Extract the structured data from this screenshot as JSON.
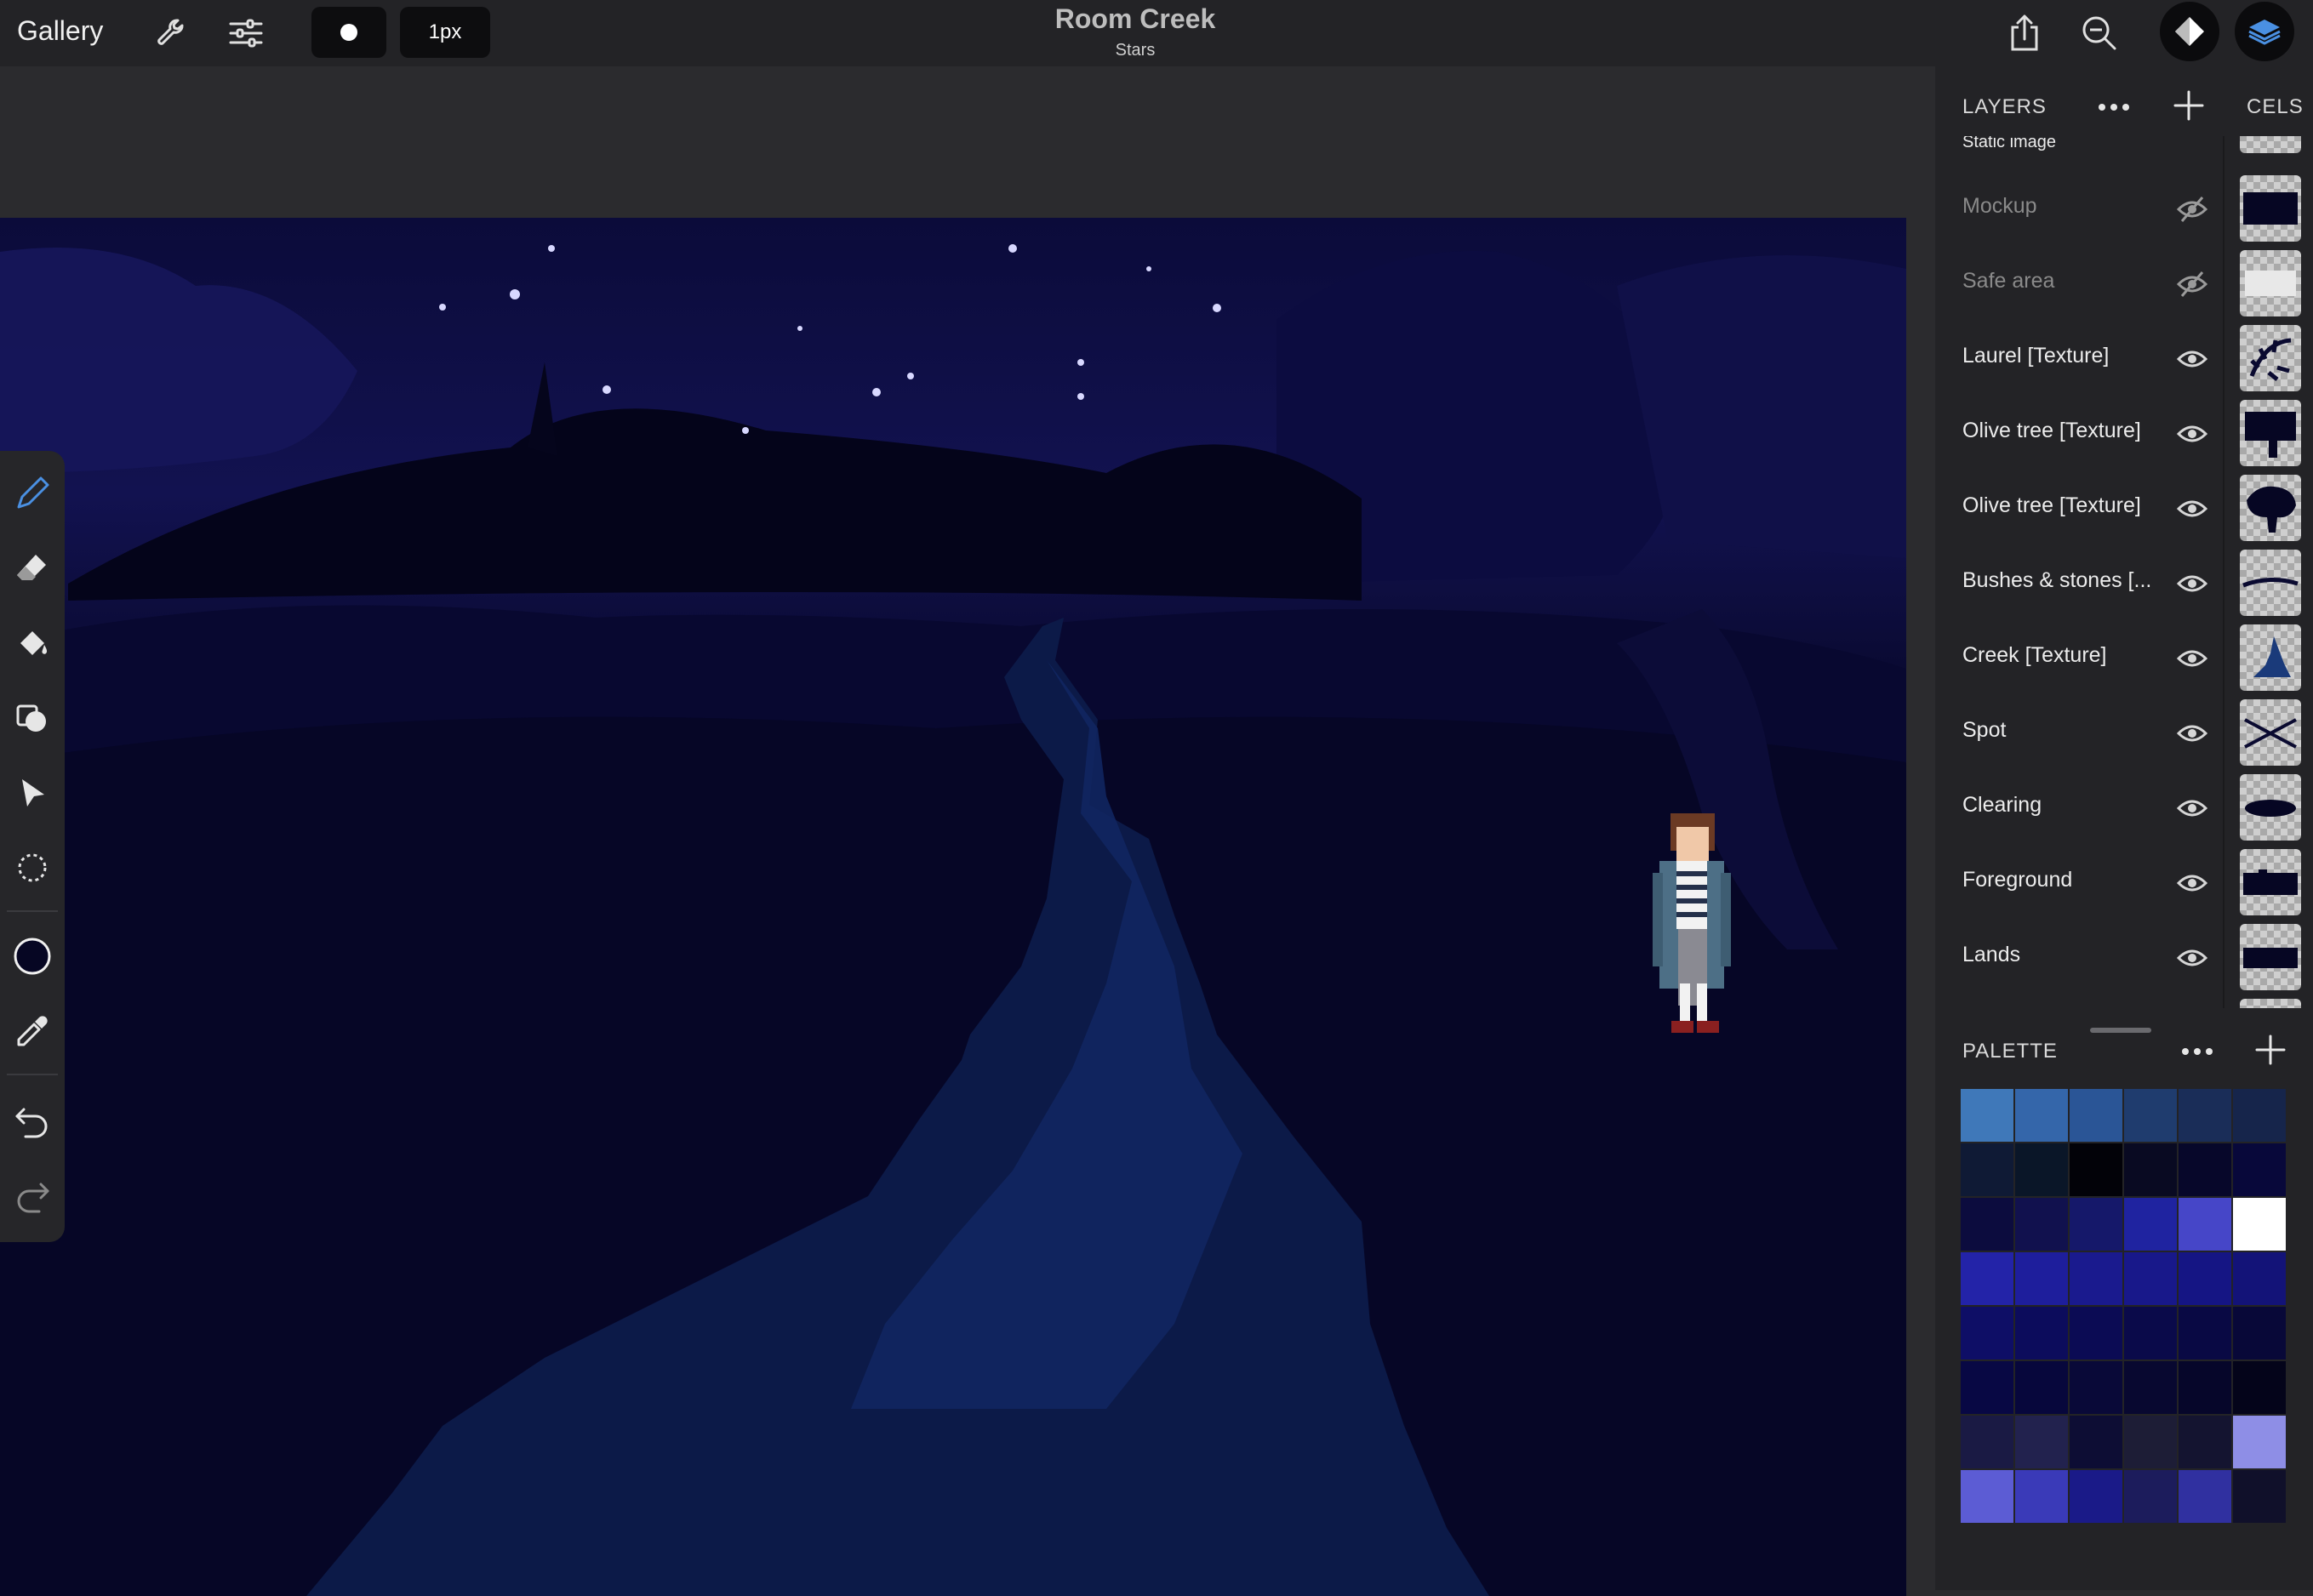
{
  "topbar": {
    "gallery_label": "Gallery",
    "brush_size_label": "1px",
    "title": "Room Creek",
    "subtitle": "Stars",
    "icons": [
      "wrench-icon",
      "adjustments-icon",
      "brush-dot-icon",
      "share-icon",
      "zoom-icon",
      "layer-diamond-icon",
      "layers-icon"
    ]
  },
  "toolbar": {
    "tools": [
      "pencil-icon",
      "eraser-icon",
      "fill-bucket-icon",
      "shapes-icon",
      "move-arrow-icon",
      "lasso-selection-icon",
      "color-circle-icon",
      "eyedropper-icon",
      "undo-icon",
      "redo-icon"
    ],
    "accent_color": "#4a90e2"
  },
  "layers_panel": {
    "header": "LAYERS",
    "cels_header": "CELS",
    "layers": [
      {
        "name": "Static image",
        "visible": true
      },
      {
        "name": "Mockup",
        "visible": false
      },
      {
        "name": "Safe area",
        "visible": false
      },
      {
        "name": "Laurel [Texture]",
        "visible": true
      },
      {
        "name": "Olive tree [Texture]",
        "visible": true
      },
      {
        "name": "Olive tree [Texture]",
        "visible": true
      },
      {
        "name": "Bushes & stones [...",
        "visible": true
      },
      {
        "name": "Creek [Texture]",
        "visible": true
      },
      {
        "name": "Spot",
        "visible": true
      },
      {
        "name": "Clearing",
        "visible": true
      },
      {
        "name": "Foreground",
        "visible": true
      },
      {
        "name": "Lands",
        "visible": true
      }
    ]
  },
  "palette_panel": {
    "header": "PALETTE",
    "colors": [
      "#3f78b9",
      "#3466aa",
      "#2a5596",
      "#1f3c6e",
      "#1a2d58",
      "#16254b",
      "#0f1a35",
      "#0a1628",
      "#020208",
      "#090a22",
      "#07072a",
      "#08083a",
      "#0c0c3e",
      "#11114e",
      "#15186a",
      "#1f23a0",
      "#4646c8",
      "#ffffff",
      "#2323a8",
      "#1e1e9c",
      "#1a1a8e",
      "#18188a",
      "#151584",
      "#131378",
      "#0e0e66",
      "#0c0c5c",
      "#0b0b54",
      "#0a0a4a",
      "#090944",
      "#080838",
      "#080844",
      "#07073c",
      "#090938",
      "#080830",
      "#06062a",
      "#04041a",
      "#1a1a44",
      "#22224e",
      "#0d0d34",
      "#1d1d36",
      "#141430",
      "#8e8ee6",
      "#5c5cd4",
      "#3a3ab8",
      "#1a1a88",
      "#1c1c5c",
      "#3030a0",
      "#10102a"
    ]
  }
}
